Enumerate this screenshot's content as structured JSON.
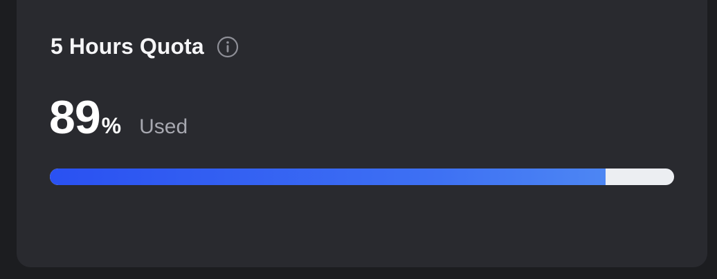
{
  "quota": {
    "title": "5 Hours Quota",
    "info_icon": "info-circle-icon",
    "percent_value": "89",
    "percent_sign": "%",
    "used_label": "Used",
    "progress_fraction": 0.89,
    "colors": {
      "card_background": "#292a2f",
      "page_background": "#1c1d20",
      "fill_start": "#2a51f2",
      "fill_end": "#4d86f3",
      "track": "#eceef2"
    }
  }
}
